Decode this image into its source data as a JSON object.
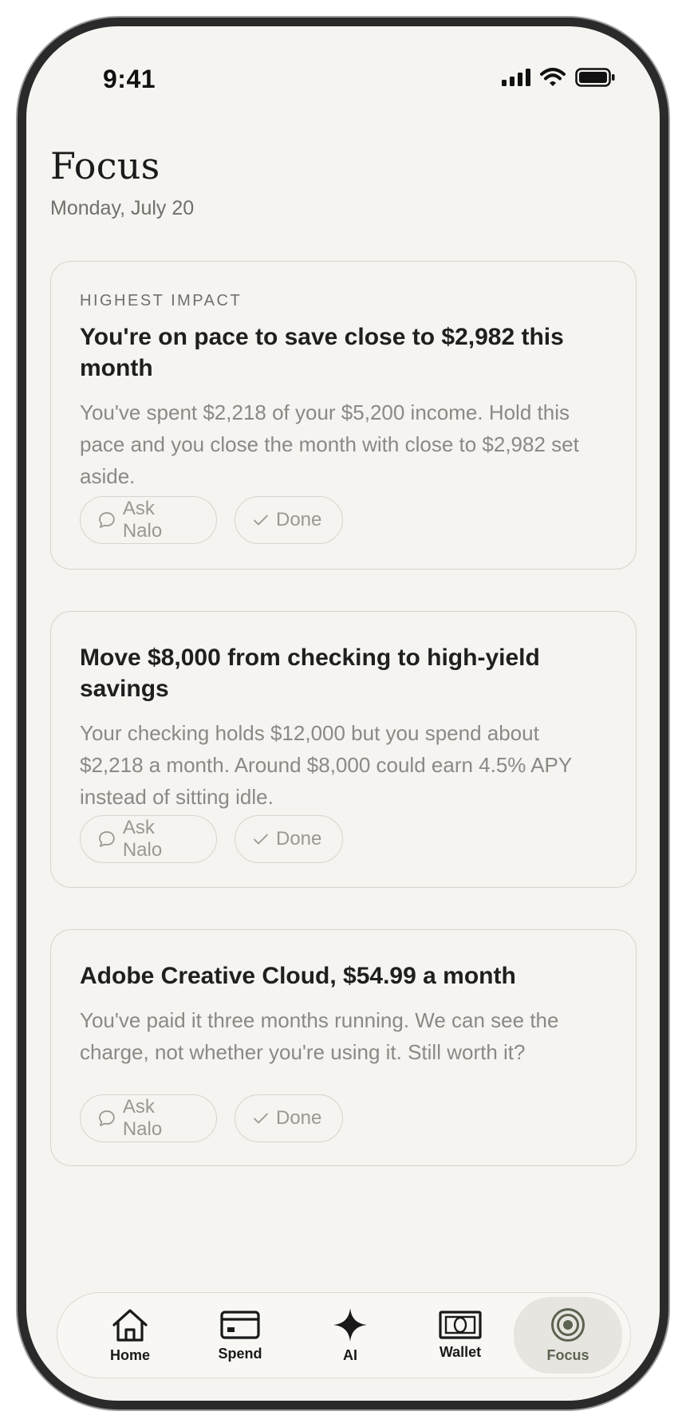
{
  "status_bar": {
    "time": "9:41",
    "icons": [
      "cellular-signal-icon",
      "wifi-icon",
      "battery-icon"
    ]
  },
  "header": {
    "title": "Focus",
    "date": "Monday, July 20"
  },
  "cards": [
    {
      "eyebrow": "HIGHEST IMPACT",
      "title": "You're on pace to save close to $2,982 this month",
      "body": "You've spent $2,218 of your $5,200 income. Hold this pace and you close the month with close to $2,982 set aside.",
      "ask_label": "Ask Nalo",
      "done_label": "Done"
    },
    {
      "title": "Move $8,000 from checking to high-yield savings",
      "body": "Your checking holds $12,000 but you spend about $2,218 a month. Around $8,000 could earn 4.5% APY instead of sitting idle.",
      "ask_label": "Ask Nalo",
      "done_label": "Done"
    },
    {
      "title": "Adobe Creative Cloud, $54.99 a month",
      "body": "You've paid it three months running. We can see the charge, not whether you're using it. Still worth it?",
      "ask_label": "Ask Nalo",
      "done_label": "Done"
    }
  ],
  "tabbar": {
    "items": [
      {
        "label": "Home",
        "icon": "home-icon"
      },
      {
        "label": "Spend",
        "icon": "card-icon"
      },
      {
        "label": "AI",
        "icon": "sparkle-icon"
      },
      {
        "label": "Wallet",
        "icon": "wallet-icon"
      },
      {
        "label": "Focus",
        "icon": "target-icon",
        "active": true
      }
    ]
  },
  "colors": {
    "background": "#f5f4f0",
    "card_border": "#d6d4cf",
    "active_tab_bg": "#e6e5e0",
    "active_tab_accent": "#5c6350",
    "body_text": "#8a8985"
  }
}
